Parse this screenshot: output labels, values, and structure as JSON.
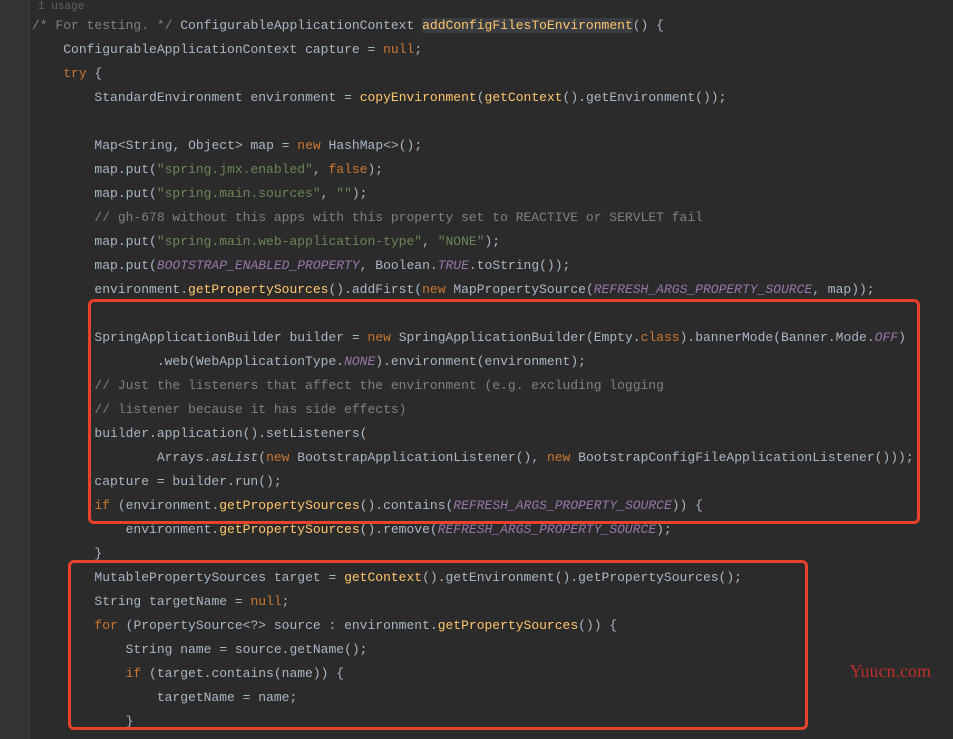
{
  "usage": "1 usage",
  "watermark": "Yuucn.com",
  "lines": [
    "<span class='c-comment'>/* For testing. */</span> <span class='c-type'>ConfigurableApplicationContext</span> <span class='c-method-hl'>addConfigFilesToEnvironment</span>() {",
    "    <span class='c-type'>ConfigurableApplicationContext</span> capture = <span class='c-keyword'>null</span>;",
    "    <span class='c-keyword'>try</span> {",
    "        <span class='c-type'>StandardEnvironment</span> environment = <span class='c-method'>copyEnvironment</span>(<span class='c-method'>getContext</span>().getEnvironment());",
    "",
    "        <span class='c-type'>Map</span>&lt;<span class='c-type'>String</span>, <span class='c-type'>Object</span>&gt; map = <span class='c-keyword'>new</span> <span class='c-type'>HashMap</span>&lt;&gt;();",
    "        map.put(<span class='c-string'>\"spring.jmx.enabled\"</span>, <span class='c-keyword'>false</span>);",
    "        map.put(<span class='c-string'>\"spring.main.sources\"</span>, <span class='c-string'>\"\"</span>);",
    "        <span class='c-comment'>// gh-678 without this apps with this property set to REACTIVE or SERVLET fail</span>",
    "        map.put(<span class='c-string'>\"spring.main.web-application-type\"</span>, <span class='c-string'>\"NONE\"</span>);",
    "        map.put(<span class='c-const'>BOOTSTRAP_ENABLED_PROPERTY</span>, <span class='c-type'>Boolean</span>.<span class='c-const'>TRUE</span>.toString());",
    "        environment.<span class='c-method'>getPropertySources</span>().addFirst(<span class='c-keyword'>new</span> <span class='c-type'>MapPropertySource</span>(<span class='c-const'>REFRESH_ARGS_PROPERTY_SOURCE</span>, map));",
    "",
    "        <span class='c-type'>SpringApplicationBuilder</span> builder = <span class='c-keyword'>new</span> <span class='c-type'>SpringApplicationBuilder</span>(<span class='c-type'>Empty</span>.<span class='c-keyword'>class</span>).bannerMode(<span class='c-type'>Banner</span>.<span class='c-type'>Mode</span>.<span class='c-const'>OFF</span>)",
    "                .web(<span class='c-type'>WebApplicationType</span>.<span class='c-const'>NONE</span>).environment(environment);",
    "        <span class='c-comment'>// Just the listeners that affect the environment (e.g. excluding logging</span>",
    "        <span class='c-comment'>// listener because it has side effects)</span>",
    "        builder.application().setListeners(",
    "                <span class='c-type'>Arrays</span>.<span class='c-italic'>asList</span>(<span class='c-keyword'>new</span> <span class='c-type'>BootstrapApplicationListener</span>(), <span class='c-keyword'>new</span> <span class='c-type'>BootstrapConfigFileApplicationListener</span>()));",
    "        capture = builder.run();",
    "        <span class='c-keyword'>if</span> (environment.<span class='c-method'>getPropertySources</span>().contains(<span class='c-const'>REFRESH_ARGS_PROPERTY_SOURCE</span>)) {",
    "            environment.<span class='c-method'>getPropertySources</span>().remove(<span class='c-const'>REFRESH_ARGS_PROPERTY_SOURCE</span>);",
    "        }",
    "        <span class='c-type'>MutablePropertySources</span> target = <span class='c-method'>getContext</span>().getEnvironment().getPropertySources();",
    "        <span class='c-type'>String</span> targetName = <span class='c-keyword'>null</span>;",
    "        <span class='c-keyword'>for</span> (<span class='c-type'>PropertySource</span>&lt;?&gt; source : environment.<span class='c-method'>getPropertySources</span>()) {",
    "            <span class='c-type'>String</span> name = source.getName();",
    "            <span class='c-keyword'>if</span> (target.contains(name)) {",
    "                targetName = name;",
    "            }"
  ]
}
